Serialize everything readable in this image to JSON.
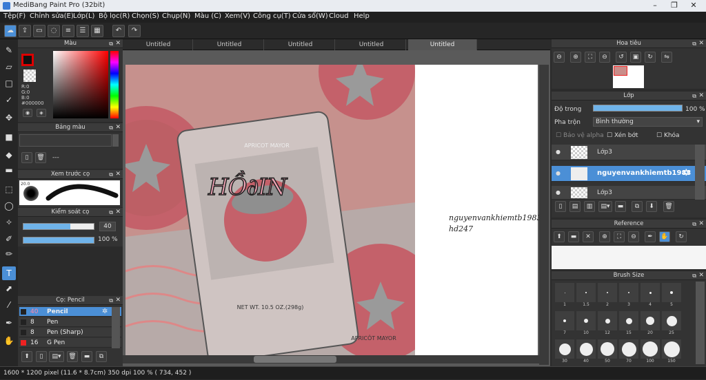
{
  "window": {
    "title": "MediBang Paint Pro (32bit)",
    "min": "–",
    "max": "❐",
    "close": "✕"
  },
  "menu": [
    "Tệp(F)",
    "Chỉnh sửa(E)",
    "Lớp(L)",
    "Bộ lọc(R)",
    "Chọn(S)",
    "Chụp(N)",
    "Màu (C)",
    "Xem(V)",
    "Công cụ(T)",
    "Cửa sổ(W)",
    "Cloud",
    "Help"
  ],
  "tabs": [
    "Untitled",
    "Untitled",
    "Untitled",
    "Untitled",
    "Untitled"
  ],
  "color_panel": {
    "title": "Màu",
    "r": "R:0",
    "g": "G:0",
    "b": "B:0",
    "hex": "#000000"
  },
  "palette_panel": {
    "title": "Bảng màu",
    "dashes": "---"
  },
  "brush_preview": {
    "title": "Xem trước cọ",
    "size": "20.0"
  },
  "brush_control": {
    "title": "Kiểm soát cọ",
    "size": "40",
    "opacity": "100 %",
    "size_level": 0.67,
    "opacity_level": 1.0
  },
  "brush_list": {
    "title": "Cọ: Pencil",
    "items": [
      {
        "size": "40",
        "name": "Pencil",
        "selected": true
      },
      {
        "size": "8",
        "name": "Pen",
        "selected": false
      },
      {
        "size": "8",
        "name": "Pen (Sharp)",
        "selected": false
      },
      {
        "size": "16",
        "name": "G Pen",
        "selected": false
      }
    ]
  },
  "canvas": {
    "art_text": "HỒ∂IN",
    "brand": "APRICOT MAYOR",
    "brand2": "APRICÔT MAYOR",
    "weight": "NET WT. 10.5 OZ.(298g)",
    "sig_line1": "nguyenvankhiemtb1983",
    "sig_line2": "hd247"
  },
  "navigator": {
    "title": "Hoa tiêu"
  },
  "layer_panel": {
    "title": "Lớp",
    "opacity_label": "Độ trong",
    "opacity_value": "100 %",
    "opacity_level": 1.0,
    "blend_label": "Pha trộn",
    "blend_value": "Bình thường",
    "protect_alpha": "Bảo vệ alpha",
    "clipping": "Xén bớt",
    "lock": "Khóa",
    "layers": [
      {
        "name": "Lớp3",
        "selected": false
      },
      {
        "name": "nguyenvankhiemtb1983",
        "selected": true
      },
      {
        "name": "Lớp3",
        "selected": false
      }
    ]
  },
  "reference_panel": {
    "title": "Reference"
  },
  "brush_size_panel": {
    "title": "Brush Size",
    "sizes": [
      "1",
      "1.5",
      "2",
      "3",
      "4",
      "5",
      "7",
      "10",
      "12",
      "15",
      "20",
      "25",
      "30",
      "40",
      "50",
      "70",
      "100",
      "150"
    ]
  },
  "status": "1600 * 1200 pixel   (11.6 * 8.7cm)   350 dpi   100 %   ( 734, 452 )",
  "colors": {
    "accent": "#4b8fd6",
    "panel": "#333333",
    "canvas_tint": "#c78a87"
  }
}
